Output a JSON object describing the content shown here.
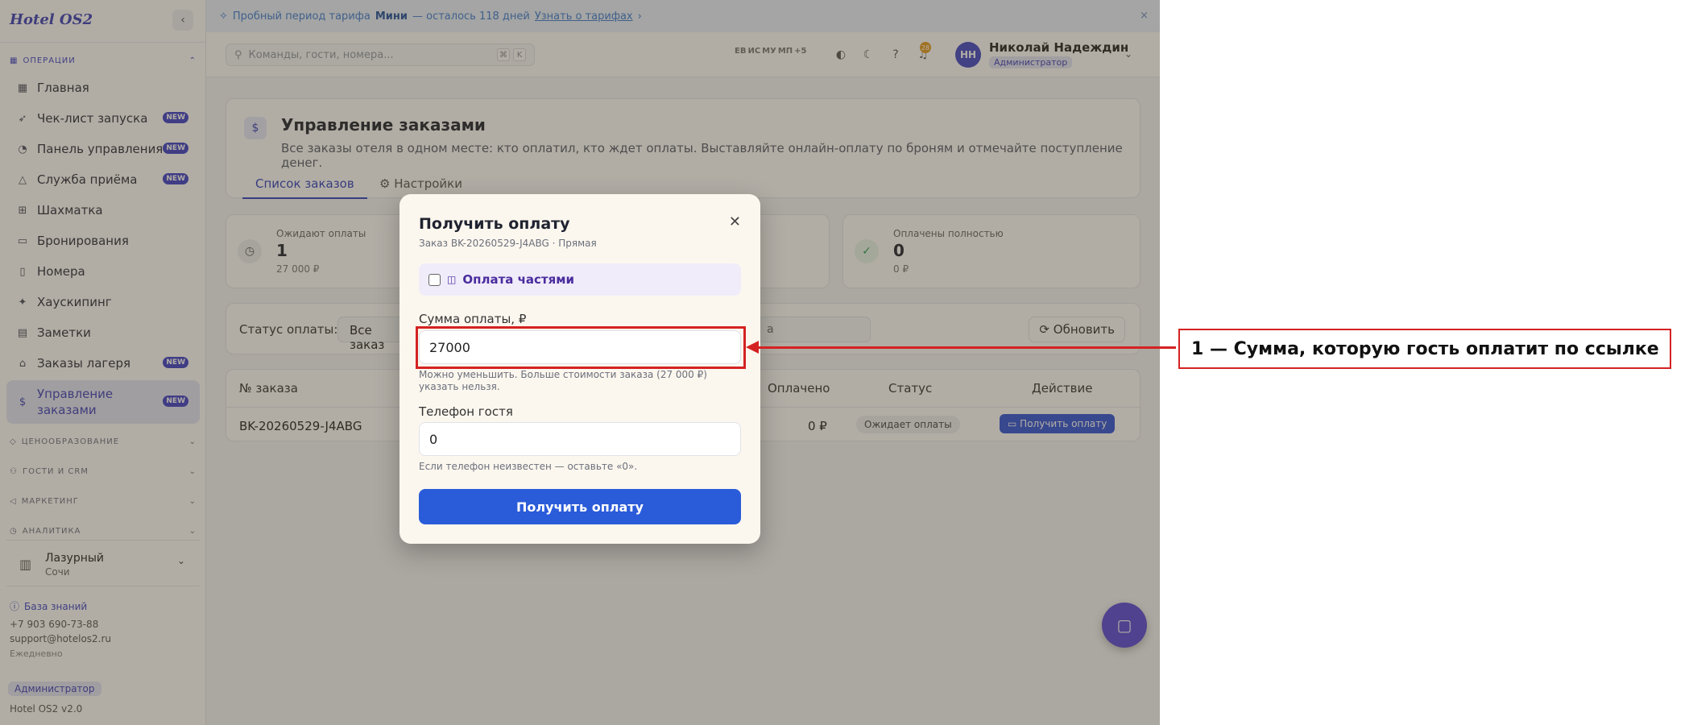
{
  "sidebar": {
    "logo": "Hotel OS2",
    "collapse_icon": "‹",
    "group_operations": "ОПЕРАЦИИ",
    "items": [
      {
        "label": "Главная",
        "icon": "home-icon",
        "new": false
      },
      {
        "label": "Чек-лист запуска",
        "icon": "rocket-icon",
        "new": true
      },
      {
        "label": "Панель управления",
        "icon": "gauge-icon",
        "new": true
      },
      {
        "label": "Служба приёма",
        "icon": "bell-icon",
        "new": true
      },
      {
        "label": "Шахматка",
        "icon": "grid-icon",
        "new": false
      },
      {
        "label": "Бронирования",
        "icon": "document-icon",
        "new": false
      },
      {
        "label": "Номера",
        "icon": "door-icon",
        "new": false
      },
      {
        "label": "Хаускипинг",
        "icon": "sparkle-icon",
        "new": false
      },
      {
        "label": "Заметки",
        "icon": "note-icon",
        "new": false
      },
      {
        "label": "Заказы лагеря",
        "icon": "tent-icon",
        "new": true
      },
      {
        "label": "Управление заказами",
        "icon": "dollar-icon",
        "new": true
      }
    ],
    "new_badge": "NEW",
    "groups": [
      "ЦЕНООБРАЗОВАНИЕ",
      "ГОСТИ И CRM",
      "МАРКЕТИНГ",
      "АНАЛИТИКА"
    ],
    "hotel": {
      "name": "Лазурный",
      "city": "Сочи"
    },
    "knowledge_base": "База знаний",
    "phone": "+7 903 690-73-88",
    "email": "support@hotelos2.ru",
    "schedule": "Ежедневно",
    "role": "Администратор",
    "version": "Hotel OS2 v2.0"
  },
  "banner": {
    "prefix": "Пробный период тарифа",
    "plan": "Мини",
    "remaining": "— осталось 118 дней",
    "link": "Узнать о тарифах",
    "close": "×"
  },
  "topbar": {
    "search_placeholder": "Команды, гости, номера...",
    "kbd1": "⌘",
    "kbd2": "K",
    "avatars": [
      "ЕВ",
      "ИС",
      "МУ",
      "МП",
      "+5"
    ],
    "notif_count": "28",
    "user_initials": "НН",
    "user_name": "Николай Надеждин",
    "user_role": "Администратор"
  },
  "page": {
    "title": "Управление заказами",
    "description": "Все заказы отеля в одном месте: кто оплатил, кто ждет оплаты. Выставляйте онлайн-оплату по броням и отмечайте поступление денег.",
    "tabs": [
      "Список заказов",
      "Настройки"
    ]
  },
  "stats": [
    {
      "label": "Ожидают оплаты",
      "value": "1",
      "sum": "27 000 ₽"
    },
    {
      "label": "Оплачены полностью",
      "value": "0",
      "sum": "0 ₽"
    }
  ],
  "filter": {
    "label": "Статус оплаты:",
    "selected": "Все заказ",
    "date_fragment": "а",
    "refresh": "Обновить"
  },
  "table": {
    "columns": [
      "№ заказа",
      "Оплачено",
      "Статус",
      "Действие"
    ],
    "rows": [
      {
        "order": "BK-20260529-J4ABG",
        "paid": "0 ₽",
        "status": "Ожидает оплаты",
        "action": "Получить оплату"
      }
    ]
  },
  "modal": {
    "title": "Получить оплату",
    "subtitle": "Заказ BK-20260529-J4ABG · Прямая",
    "installments": "Оплата частями",
    "amount_label": "Сумма оплаты, ₽",
    "amount_value": "27000",
    "amount_hint": "Можно уменьшить. Больше стоимости заказа (27 000 ₽) указать нельзя.",
    "phone_label": "Телефон гостя",
    "phone_value": "0",
    "phone_hint": "Если телефон неизвестен — оставьте «0».",
    "submit": "Получить оплату"
  },
  "annotation": {
    "callout": "1 — Сумма, которую гость оплатит по ссылке"
  }
}
